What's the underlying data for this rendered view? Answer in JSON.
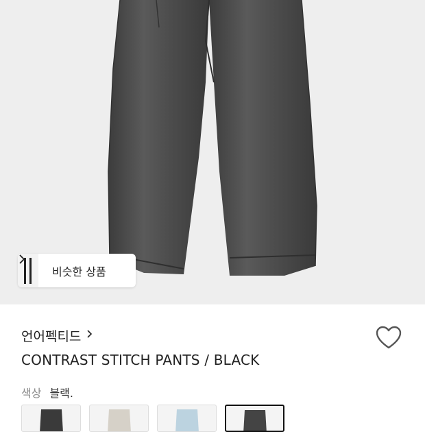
{
  "similar": {
    "label": "비슷한 상품",
    "arrow_icon": "chevron-right-icon"
  },
  "brand": {
    "name": "언어펙티드",
    "arrow_icon": "chevron-right-icon"
  },
  "product": {
    "title": "CONTRAST STITCH PANTS / BLACK"
  },
  "wishlist": {
    "icon": "heart-outline-icon"
  },
  "color": {
    "label": "색상",
    "value": "블랙."
  },
  "swatches": [
    {
      "color": "#3a3a3a",
      "selected": false
    },
    {
      "color": "#cfcac1",
      "selected": false
    },
    {
      "color": "#b9d0de",
      "selected": false
    },
    {
      "color": "#444444",
      "selected": true
    }
  ],
  "colors": {
    "hero_background": "#eeeeee",
    "pants": "#4a4a4a"
  }
}
